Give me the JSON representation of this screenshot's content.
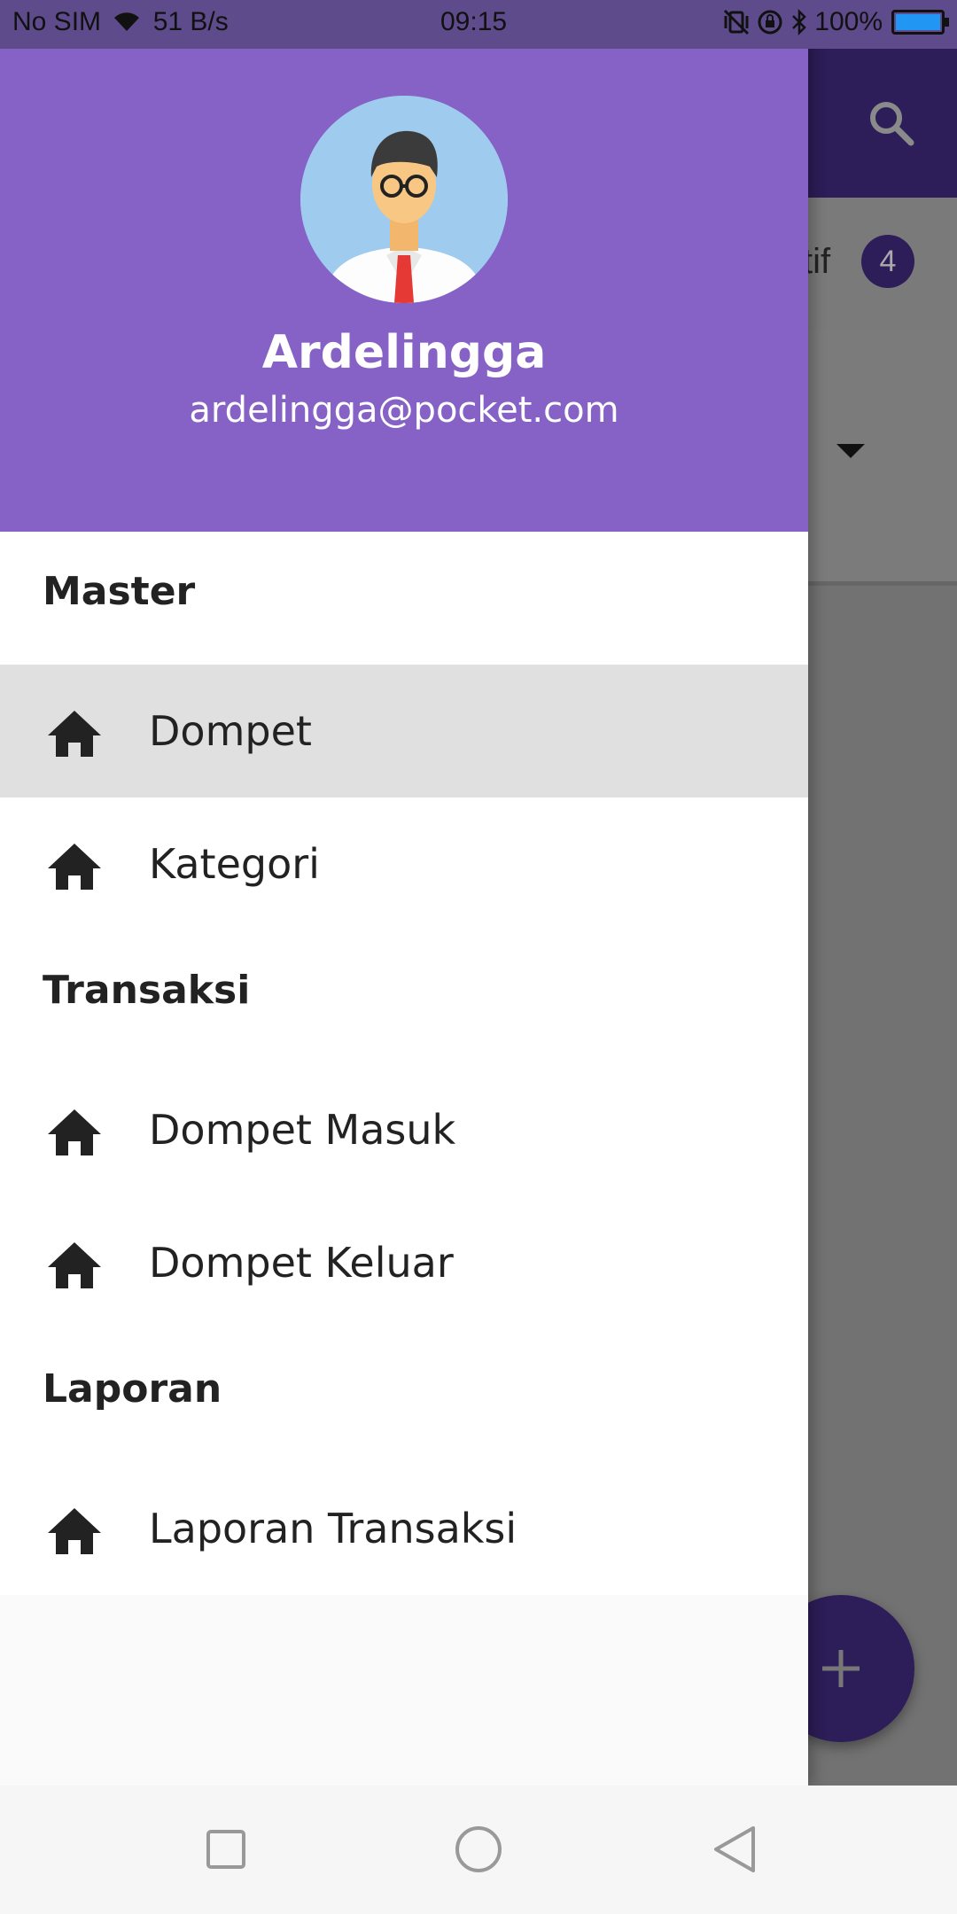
{
  "status_bar": {
    "carrier": "No SIM",
    "network_speed": "51 B/s",
    "time": "09:15",
    "battery": "100%"
  },
  "app": {
    "tab_label": "ktif",
    "tab_badge": "4",
    "colors": {
      "toolbar": "#2d1d58",
      "accent": "#8662c6"
    }
  },
  "drawer": {
    "user": {
      "name": "Ardelingga",
      "email": "ardelingga@pocket.com"
    },
    "sections": [
      {
        "title": "Master",
        "items": [
          {
            "label": "Dompet",
            "icon": "home-icon",
            "active": true
          },
          {
            "label": "Kategori",
            "icon": "home-icon",
            "active": false
          }
        ]
      },
      {
        "title": "Transaksi",
        "items": [
          {
            "label": "Dompet Masuk",
            "icon": "home-icon",
            "active": false
          },
          {
            "label": "Dompet Keluar",
            "icon": "home-icon",
            "active": false
          }
        ]
      },
      {
        "title": "Laporan",
        "items": [
          {
            "label": "Laporan Transaksi",
            "icon": "home-icon",
            "active": false
          }
        ]
      }
    ]
  },
  "nav_bar": {
    "icons": [
      "recent-apps-icon",
      "home-circle-icon",
      "back-triangle-icon"
    ]
  }
}
